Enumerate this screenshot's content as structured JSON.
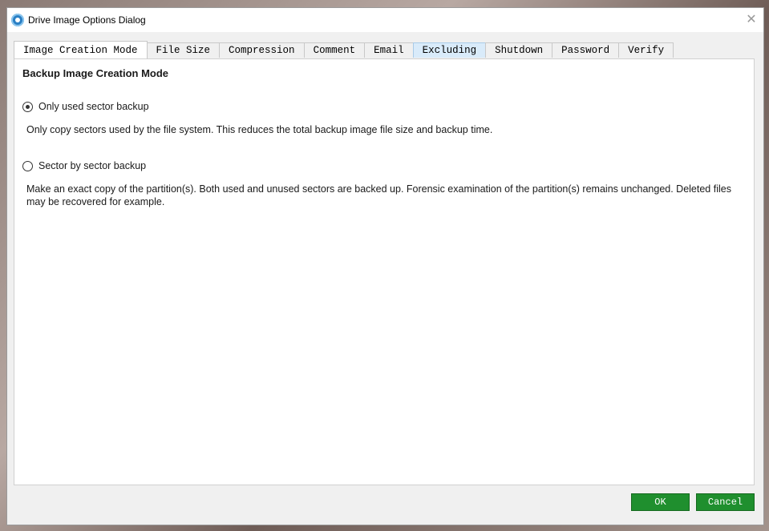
{
  "window": {
    "title": "Drive Image Options Dialog"
  },
  "tabs": [
    {
      "label": "Image Creation Mode",
      "active": true
    },
    {
      "label": "File Size"
    },
    {
      "label": "Compression"
    },
    {
      "label": "Comment"
    },
    {
      "label": "Email"
    },
    {
      "label": "Excluding",
      "hover": true
    },
    {
      "label": "Shutdown"
    },
    {
      "label": "Password"
    },
    {
      "label": "Verify"
    }
  ],
  "panel": {
    "heading": "Backup Image Creation Mode",
    "options": [
      {
        "label": "Only used sector backup",
        "selected": true,
        "description": "Only copy sectors used by the file system. This reduces the total backup image file size and backup time."
      },
      {
        "label": "Sector by sector backup",
        "selected": false,
        "description": "Make an exact copy of the partition(s). Both used and unused sectors are backed up. Forensic examination of the partition(s) remains unchanged. Deleted files may be recovered for example."
      }
    ]
  },
  "buttons": {
    "ok": "OK",
    "cancel": "Cancel"
  },
  "colors": {
    "button_green": "#1f8f2e",
    "tab_hover": "#d9ebfa"
  }
}
